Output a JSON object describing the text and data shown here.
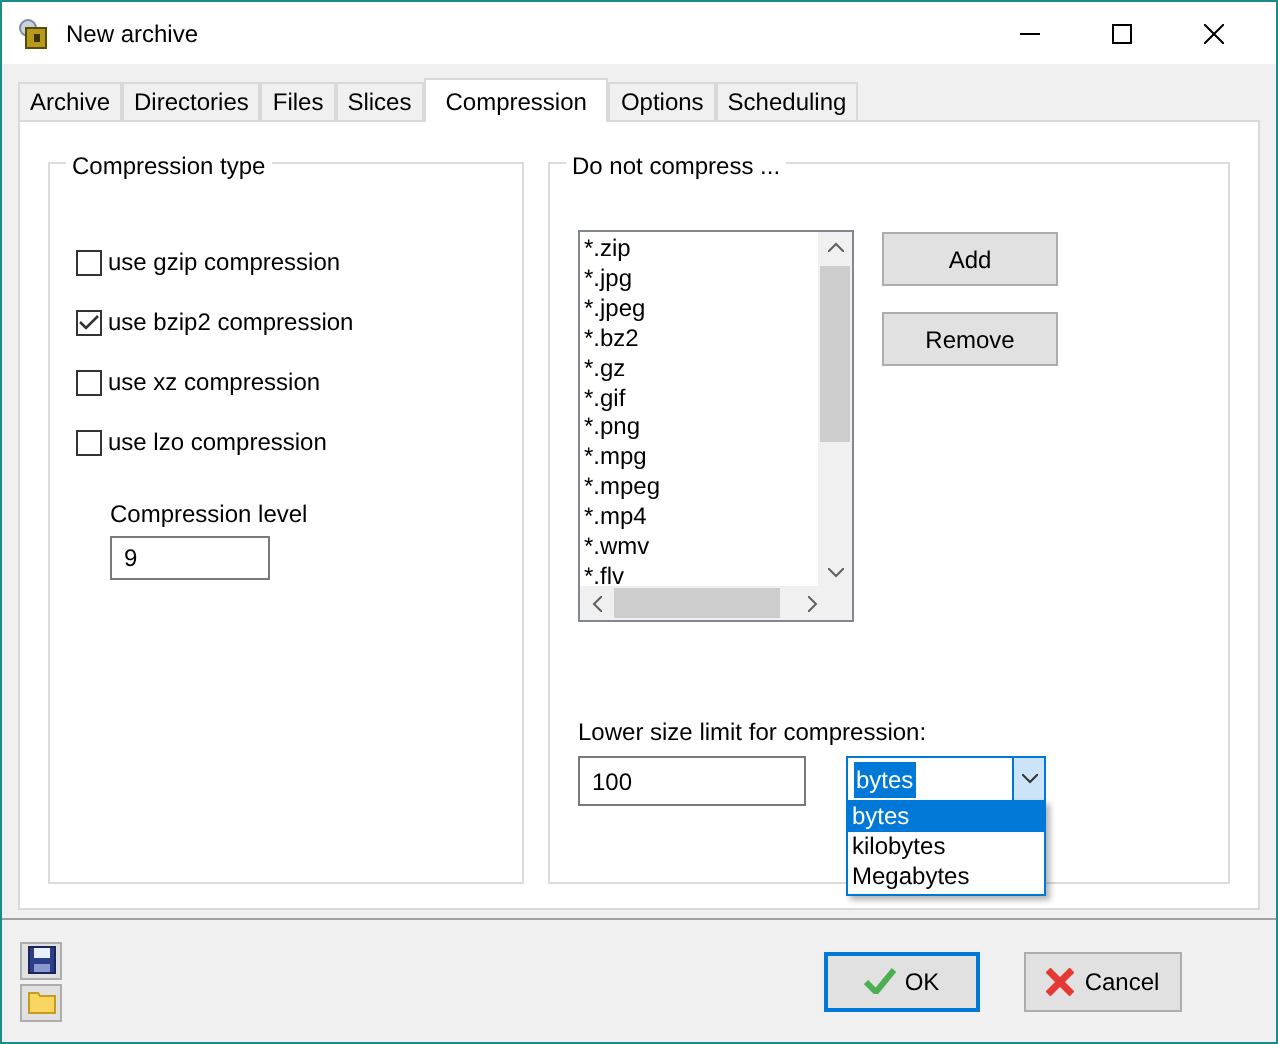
{
  "window": {
    "title": "New archive"
  },
  "tabs": [
    {
      "label": "Archive",
      "selected": false
    },
    {
      "label": "Directories",
      "selected": false
    },
    {
      "label": "Files",
      "selected": false
    },
    {
      "label": "Slices",
      "selected": false
    },
    {
      "label": "Compression",
      "selected": true
    },
    {
      "label": "Options",
      "selected": false
    },
    {
      "label": "Scheduling",
      "selected": false
    }
  ],
  "compression_type": {
    "title": "Compression type",
    "options": [
      {
        "label": "use gzip compression",
        "checked": false
      },
      {
        "label": "use bzip2 compression",
        "checked": true
      },
      {
        "label": "use xz compression",
        "checked": false
      },
      {
        "label": "use lzo compression",
        "checked": false
      }
    ],
    "level_label": "Compression level",
    "level_value": "9"
  },
  "do_not_compress": {
    "title": "Do not compress ...",
    "patterns": [
      "*.zip",
      "*.jpg",
      "*.jpeg",
      "*.bz2",
      "*.gz",
      "*.gif",
      "*.png",
      "*.mpg",
      "*.mpeg",
      "*.mp4",
      "*.wmv",
      "*.flv"
    ],
    "buttons": [
      "Add",
      "Remove"
    ],
    "size_limit_label": "Lower size limit for compression:",
    "size_limit_value": "100",
    "unit_value": "bytes",
    "unit_options": [
      {
        "label": "bytes",
        "selected": true
      },
      {
        "label": "kilobytes",
        "selected": false
      },
      {
        "label": "Megabytes",
        "selected": false
      }
    ]
  },
  "footer_buttons": [
    {
      "label": "OK",
      "kind": "ok"
    },
    {
      "label": "Cancel",
      "kind": "cancel"
    }
  ]
}
